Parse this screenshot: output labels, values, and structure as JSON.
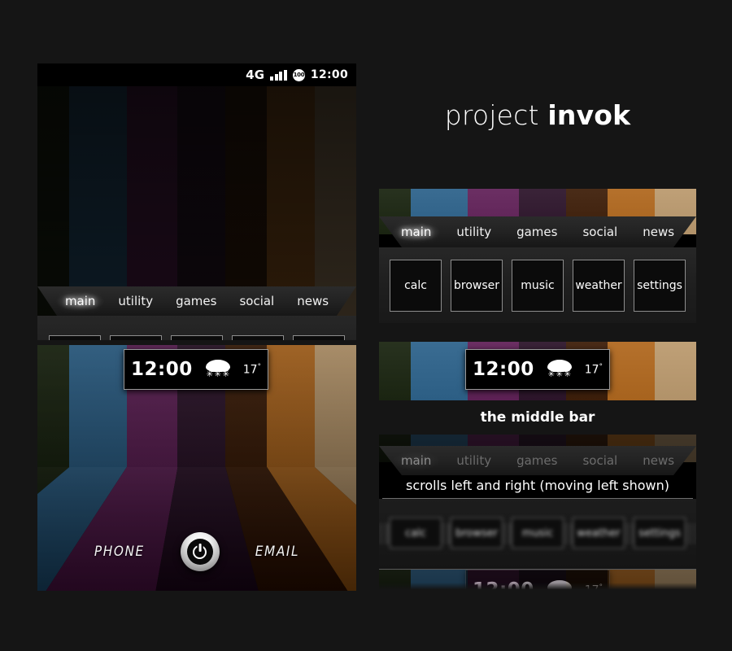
{
  "page": {
    "background_color": "#151515",
    "title_light": "project",
    "title_bold": "invok"
  },
  "statusbar": {
    "network": "4G",
    "signal_icon": "signal-bars-icon",
    "battery_icon": "battery-circle-icon",
    "battery_level": "100",
    "time": "12:00"
  },
  "tabs": [
    {
      "label": "main",
      "active": true
    },
    {
      "label": "utility",
      "active": false
    },
    {
      "label": "games",
      "active": false
    },
    {
      "label": "social",
      "active": false
    },
    {
      "label": "news",
      "active": false
    }
  ],
  "apps": [
    {
      "label": "calc"
    },
    {
      "label": "browser"
    },
    {
      "label": "music"
    },
    {
      "label": "weather"
    },
    {
      "label": "settings"
    }
  ],
  "widget": {
    "time": "12:00",
    "weather_icon": "snow-cloud-icon",
    "temperature": "17",
    "degree_symbol": "°"
  },
  "dock": {
    "left_label": "PHONE",
    "home_icon": "power-button-icon",
    "right_label": "EMAIL"
  },
  "captions": {
    "middle_bar": "the middle bar",
    "scroll": "scrolls left and right (moving left shown)"
  },
  "wallpaper": {
    "stripe_colors": [
      "#28321f",
      "#3a6c92",
      "#6b2f63",
      "#3a2338",
      "#4a2c18",
      "#b5712c",
      "#bfa077"
    ]
  },
  "theme": {
    "panel_black": "#000000",
    "shelf_top": "#2b2b2b",
    "shelf_bottom": "#171717",
    "drawer_top": "#272727",
    "drawer_bottom": "#191919",
    "button_border": "#8d8d8d",
    "text_white": "#ffffff",
    "text_dim": "#6c6c6c"
  }
}
